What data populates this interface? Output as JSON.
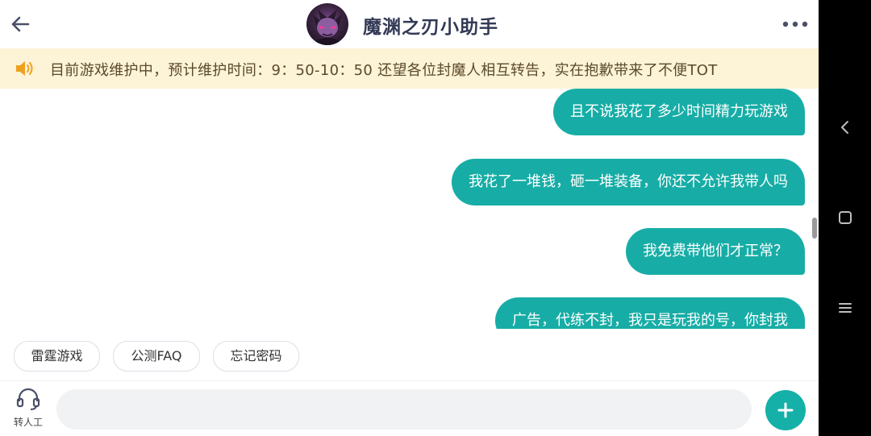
{
  "header": {
    "title": "魔渊之刃小助手",
    "back_icon": "arrow-left-icon",
    "more_icon": "more-horizontal-icon",
    "avatar_icon": "character-avatar"
  },
  "notice": {
    "icon": "speaker-icon",
    "text": "目前游戏维护中，预计维护时间：9：50-10：50 还望各位封魔人相互转告，实在抱歉带来了不便TOT",
    "background": "#fdf3d6"
  },
  "messages": [
    {
      "sender": "user",
      "text": "且不说我花了多少时间精力玩游戏"
    },
    {
      "sender": "user",
      "text": "我花了一堆钱，砸一堆装备，你还不允许我带人吗"
    },
    {
      "sender": "user",
      "text": "我免费带他们才正常？"
    },
    {
      "sender": "user",
      "text": "广告，代练不封，我只是玩我的号，你封我"
    }
  ],
  "quick_replies": [
    "雷霆游戏",
    "公测FAQ",
    "忘记密码"
  ],
  "input_bar": {
    "agent_label": "转人工",
    "agent_icon": "headset-icon",
    "input_value": "",
    "placeholder": "",
    "plus_icon": "plus-icon"
  },
  "system_nav": {
    "back": "chevron-left-icon",
    "home": "square-icon",
    "menu": "menu-lines-icon"
  },
  "colors": {
    "accent": "#17ada6",
    "title": "#333a55",
    "notice_text": "#5a4a2a"
  }
}
